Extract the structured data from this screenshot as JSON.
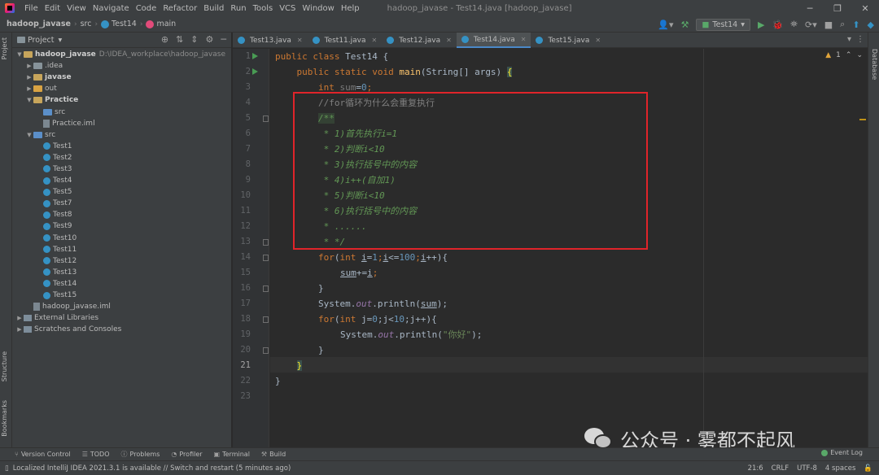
{
  "menubar": {
    "items": [
      "File",
      "Edit",
      "View",
      "Navigate",
      "Code",
      "Refactor",
      "Build",
      "Run",
      "Tools",
      "VCS",
      "Window",
      "Help"
    ],
    "window_title": "hadoop_javase - Test14.java [hadoop_javase]"
  },
  "navbar": {
    "project": "hadoop_javase",
    "folder": "src",
    "class": "Test14",
    "method": "main",
    "run_config": "Test14"
  },
  "project_panel": {
    "title": "Project",
    "tree": [
      {
        "label": "hadoop_javase",
        "extra": "D:\\IDEA_workplace\\hadoop_javase",
        "level": 0,
        "kind": "folder-yellow",
        "arrow": "down",
        "bold": true
      },
      {
        "label": ".idea",
        "level": 1,
        "kind": "folder",
        "arrow": "right"
      },
      {
        "label": "javase",
        "level": 1,
        "kind": "folder-yellow",
        "arrow": "right",
        "bold": true
      },
      {
        "label": "out",
        "level": 1,
        "kind": "folder-orange",
        "arrow": "right"
      },
      {
        "label": "Practice",
        "level": 1,
        "kind": "folder-yellow",
        "arrow": "down",
        "bold": true
      },
      {
        "label": "src",
        "level": 2,
        "kind": "folder-blue",
        "arrow": ""
      },
      {
        "label": "Practice.iml",
        "level": 2,
        "kind": "file",
        "arrow": ""
      },
      {
        "label": "src",
        "level": 1,
        "kind": "folder-blue",
        "arrow": "down"
      },
      {
        "label": "Test1",
        "level": 2,
        "kind": "class",
        "arrow": ""
      },
      {
        "label": "Test2",
        "level": 2,
        "kind": "class",
        "arrow": ""
      },
      {
        "label": "Test3",
        "level": 2,
        "kind": "class",
        "arrow": ""
      },
      {
        "label": "Test4",
        "level": 2,
        "kind": "class",
        "arrow": ""
      },
      {
        "label": "Test5",
        "level": 2,
        "kind": "class",
        "arrow": ""
      },
      {
        "label": "Test7",
        "level": 2,
        "kind": "class",
        "arrow": ""
      },
      {
        "label": "Test8",
        "level": 2,
        "kind": "class",
        "arrow": ""
      },
      {
        "label": "Test9",
        "level": 2,
        "kind": "class",
        "arrow": ""
      },
      {
        "label": "Test10",
        "level": 2,
        "kind": "class",
        "arrow": ""
      },
      {
        "label": "Test11",
        "level": 2,
        "kind": "class",
        "arrow": ""
      },
      {
        "label": "Test12",
        "level": 2,
        "kind": "class",
        "arrow": ""
      },
      {
        "label": "Test13",
        "level": 2,
        "kind": "class",
        "arrow": ""
      },
      {
        "label": "Test14",
        "level": 2,
        "kind": "class",
        "arrow": ""
      },
      {
        "label": "Test15",
        "level": 2,
        "kind": "class",
        "arrow": ""
      },
      {
        "label": "hadoop_javase.iml",
        "level": 1,
        "kind": "file",
        "arrow": ""
      },
      {
        "label": "External Libraries",
        "level": 0,
        "kind": "lib",
        "arrow": "right"
      },
      {
        "label": "Scratches and Consoles",
        "level": 0,
        "kind": "lib",
        "arrow": "right"
      }
    ]
  },
  "editor_tabs": [
    "Test13.java",
    "Test11.java",
    "Test12.java",
    "Test14.java",
    "Test15.java"
  ],
  "active_tab": "Test14.java",
  "editor": {
    "warning_count": "1",
    "line_numbers": [
      "1",
      "2",
      "3",
      "4",
      "5",
      "6",
      "7",
      "8",
      "9",
      "10",
      "11",
      "12",
      "13",
      "14",
      "15",
      "16",
      "17",
      "18",
      "19",
      "20",
      "21",
      "22",
      "23"
    ],
    "code": {
      "l1_kw": "public class ",
      "l1_name": "Test14 {",
      "l2_kw": "public static void ",
      "l2_mth": "main",
      "l2_rest": "(String[] args) ",
      "l2_brace": "{",
      "l3_kw": "int ",
      "l3_var": "sum",
      "l3_eq": "=",
      "l3_num": "0",
      "l3_semi": ";",
      "l4": "//for循环为什么会重复执行",
      "l5": "/**",
      "l6": " * 1)首先执行i=1",
      "l7": " * 2)判断i<10",
      "l8": " * 3)执行括号中的内容",
      "l9": " * 4)i++(自加1)",
      "l10": " * 5)判断i<10",
      "l11": " * 6)执行括号中的内容",
      "l12": " * ......",
      "l13": " * */",
      "l14_kw": "for",
      "l14_a": "(",
      "l14_kw2": "int ",
      "l14_i1": "i",
      "l14_b": "=",
      "l14_n1": "1",
      "l14_c": ";",
      "l14_i2": "i",
      "l14_d": "<=",
      "l14_n2": "100",
      "l14_e": ";",
      "l14_i3": "i",
      "l14_f": "++){",
      "l15_a": "sum",
      "l15_b": "+=",
      "l15_c": "i",
      "l15_d": ";",
      "l16": "}",
      "l17_a": "System.",
      "l17_out": "out",
      "l17_b": ".println(",
      "l17_c": "sum",
      "l17_d": ");",
      "l18_kw": "for",
      "l18_a": "(",
      "l18_kw2": "int ",
      "l18_b": "j=",
      "l18_n1": "0",
      "l18_c": ";j<",
      "l18_n2": "10",
      "l18_d": ";j++){",
      "l19_a": "System.",
      "l19_out": "out",
      "l19_b": ".println(",
      "l19_str": "\"你好\"",
      "l19_c": ");",
      "l20": "}",
      "l21": "}",
      "l22": "}"
    }
  },
  "left_strip": {
    "project": "Project",
    "structure": "Structure",
    "bookmarks": "Bookmarks"
  },
  "right_strip": {
    "database": "Database"
  },
  "bottom_tools": [
    "Version Control",
    "TODO",
    "Problems",
    "Profiler",
    "Terminal",
    "Build"
  ],
  "event_log": "Event Log",
  "status": {
    "message": "Localized IntelliJ IDEA 2021.3.1 is available // Switch and restart (5 minutes ago)",
    "position": "21:6",
    "line_sep": "CRLF",
    "encoding": "UTF-8",
    "indent": "4 spaces"
  },
  "watermark": {
    "text": "公众号 · 雾都不起风"
  },
  "colors": {
    "annotation_box": "#e0242a",
    "accent": "#4a88c7",
    "run_green": "#499c54"
  }
}
